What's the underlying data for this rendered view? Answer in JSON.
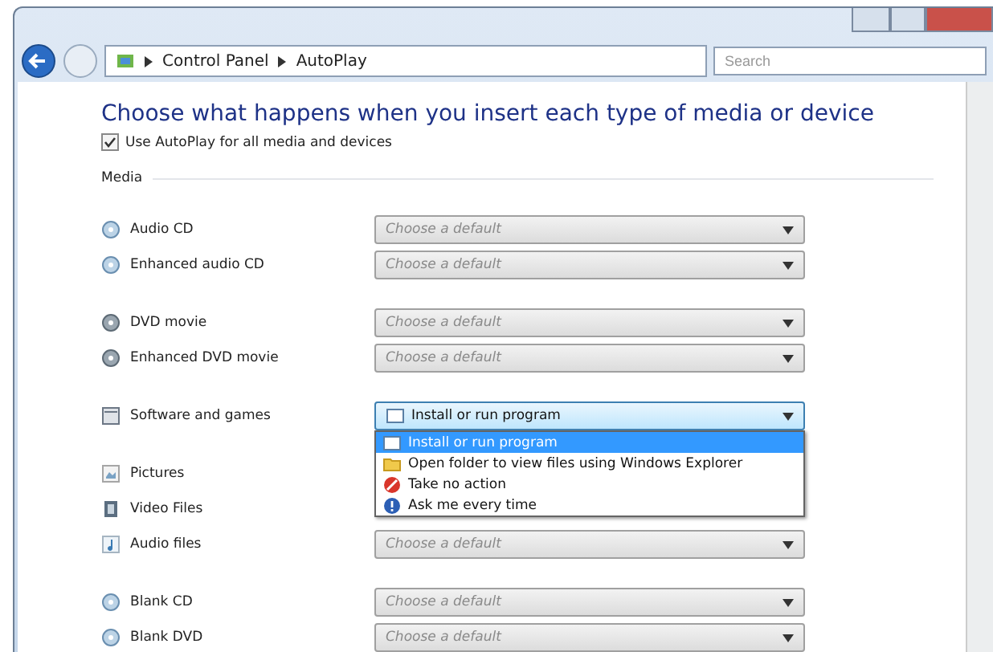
{
  "address_bar": {
    "breadcrumbs": [
      "Control Panel",
      "AutoPlay"
    ],
    "search": {
      "placeholder": "Search"
    }
  },
  "heading": "Choose what happens when you insert each type of media or device",
  "use_autoplay": {
    "label": "Use AutoPlay for all media and devices",
    "checked": true
  },
  "section": "Media",
  "groups": [
    {
      "rows": [
        {
          "label": "Audio CD",
          "kind": "disc",
          "select": {
            "placeholder": "Choose a default"
          }
        },
        {
          "label": "Enhanced audio CD",
          "kind": "disc",
          "select": {
            "placeholder": "Choose a default"
          }
        }
      ]
    },
    {
      "rows": [
        {
          "label": "DVD movie",
          "kind": "dvd",
          "select": {
            "placeholder": "Choose a default"
          }
        },
        {
          "label": "Enhanced DVD movie",
          "kind": "dvd",
          "select": {
            "placeholder": "Choose a default"
          }
        }
      ]
    },
    {
      "rows": [
        {
          "label": "Software and games",
          "kind": "software",
          "select": {
            "value": "Install or run program",
            "expanded": true,
            "options": [
              {
                "label": "Install or run program",
                "kind": "window",
                "selected": true
              },
              {
                "label": "Open folder to view files using Windows Explorer",
                "kind": "folder",
                "selected": false
              },
              {
                "label": "Take no action",
                "kind": "stop",
                "selected": false
              },
              {
                "label": "Ask me every time",
                "kind": "question",
                "selected": false
              }
            ]
          }
        }
      ]
    },
    {
      "rows": [
        {
          "label": "Pictures",
          "kind": "picture"
        },
        {
          "label": "Video Files",
          "kind": "film"
        },
        {
          "label": "Audio files",
          "kind": "music",
          "select": {
            "placeholder": "Choose a default"
          }
        }
      ]
    },
    {
      "rows": [
        {
          "label": "Blank CD",
          "kind": "disc",
          "select": {
            "placeholder": "Choose a default"
          }
        },
        {
          "label": "Blank DVD",
          "kind": "disc",
          "select": {
            "placeholder": "Choose a default"
          }
        }
      ]
    }
  ]
}
